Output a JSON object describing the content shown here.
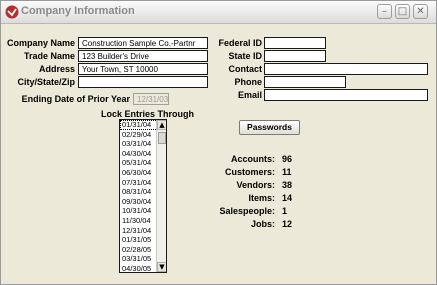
{
  "window": {
    "title": "Company Information"
  },
  "form": {
    "company_name": {
      "label": "Company Name",
      "value": "Construction Sample Co.-Partnr"
    },
    "trade_name": {
      "label": "Trade Name",
      "value": "123 Builder's Drive"
    },
    "address": {
      "label": "Address",
      "value": "Your Town, ST  10000"
    },
    "city_state_zip": {
      "label": "City/State/Zip",
      "value": ""
    },
    "ending_date": {
      "label": "Ending Date of Prior Year",
      "value": "12/31/03"
    },
    "federal_id": {
      "label": "Federal ID",
      "value": ""
    },
    "state_id": {
      "label": "State ID",
      "value": ""
    },
    "contact": {
      "label": "Contact",
      "value": ""
    },
    "phone": {
      "label": "Phone",
      "value": ""
    },
    "email": {
      "label": "Email",
      "value": ""
    }
  },
  "lock": {
    "label": "Lock Entries Through",
    "items": [
      "01/31/04",
      "02/29/04",
      "03/31/04",
      "04/30/04",
      "05/31/04",
      "06/30/04",
      "07/31/04",
      "08/31/04",
      "09/30/04",
      "10/31/04",
      "11/30/04",
      "12/31/04",
      "01/31/05",
      "02/28/05",
      "03/31/05",
      "04/30/05"
    ],
    "selected": "01/31/04"
  },
  "passwords_button": "Passwords",
  "counts": [
    {
      "label": "Accounts:",
      "value": "96"
    },
    {
      "label": "Customers:",
      "value": "11"
    },
    {
      "label": "Vendors:",
      "value": "38"
    },
    {
      "label": "Items:",
      "value": "14"
    },
    {
      "label": "Salespeople:",
      "value": "1"
    },
    {
      "label": "Jobs:",
      "value": "12"
    }
  ]
}
